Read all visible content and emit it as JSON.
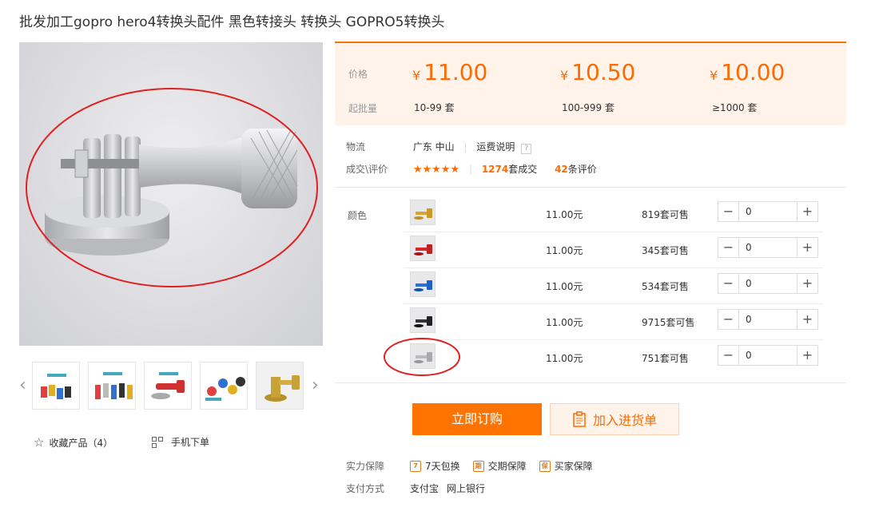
{
  "page": {
    "title": "批发加工gopro hero4转换头配件 黑色转接头 转换头 GOPRO5转换头"
  },
  "gallery": {
    "prev_arrow": "‹",
    "next_arrow": "›",
    "thumbnails": [
      "thumb-multicolor-set",
      "thumb-multicolor-set",
      "thumb-red-adapter",
      "thumb-colored-set",
      "thumb-gold-adapter"
    ]
  },
  "actions": {
    "favorite_label": "收藏产品（4）",
    "mobile_label": "手机下单"
  },
  "price_box": {
    "price_label": "价格",
    "moq_label": "起批量",
    "currency": "¥",
    "tiers": [
      {
        "price": "11.00",
        "qty": "10-99 套"
      },
      {
        "price": "10.50",
        "qty": "100-999 套"
      },
      {
        "price": "10.00",
        "qty": "≥1000 套"
      }
    ]
  },
  "logistics": {
    "label": "物流",
    "location": "广东 中山",
    "shipping_link": "运费说明",
    "help": "?"
  },
  "trade": {
    "label": "成交\\评价",
    "stars": "★★★★★",
    "deals_count": "1274",
    "deals_suffix": "套成交",
    "reviews_count": "42",
    "reviews_suffix": "条评价"
  },
  "sku": {
    "label": "颜色",
    "rows": [
      {
        "swatch": "gold",
        "price": "11.00元",
        "stock": "819套可售",
        "qty": "0"
      },
      {
        "swatch": "red",
        "price": "11.00元",
        "stock": "345套可售",
        "qty": "0"
      },
      {
        "swatch": "blue",
        "price": "11.00元",
        "stock": "534套可售",
        "qty": "0"
      },
      {
        "swatch": "black",
        "price": "11.00元",
        "stock": "9715套可售",
        "qty": "0"
      },
      {
        "swatch": "silver",
        "price": "11.00元",
        "stock": "751套可售",
        "qty": "0"
      }
    ],
    "minus": "−",
    "plus": "+"
  },
  "buttons": {
    "buy_now": "立即订购",
    "add_to_list": "加入进货单"
  },
  "guarantee": {
    "label": "实力保障",
    "items": [
      {
        "icon": "7",
        "text": "7天包换"
      },
      {
        "icon": "期",
        "text": "交期保障"
      },
      {
        "icon": "保",
        "text": "买家保障"
      }
    ]
  },
  "payment": {
    "label": "支付方式",
    "methods": [
      "支付宝",
      "网上银行"
    ]
  },
  "colors": {
    "accent": "#ff6a00",
    "buy_button": "#ff7300",
    "price_bg": "#fff3ea",
    "annotation": "#e02020"
  }
}
